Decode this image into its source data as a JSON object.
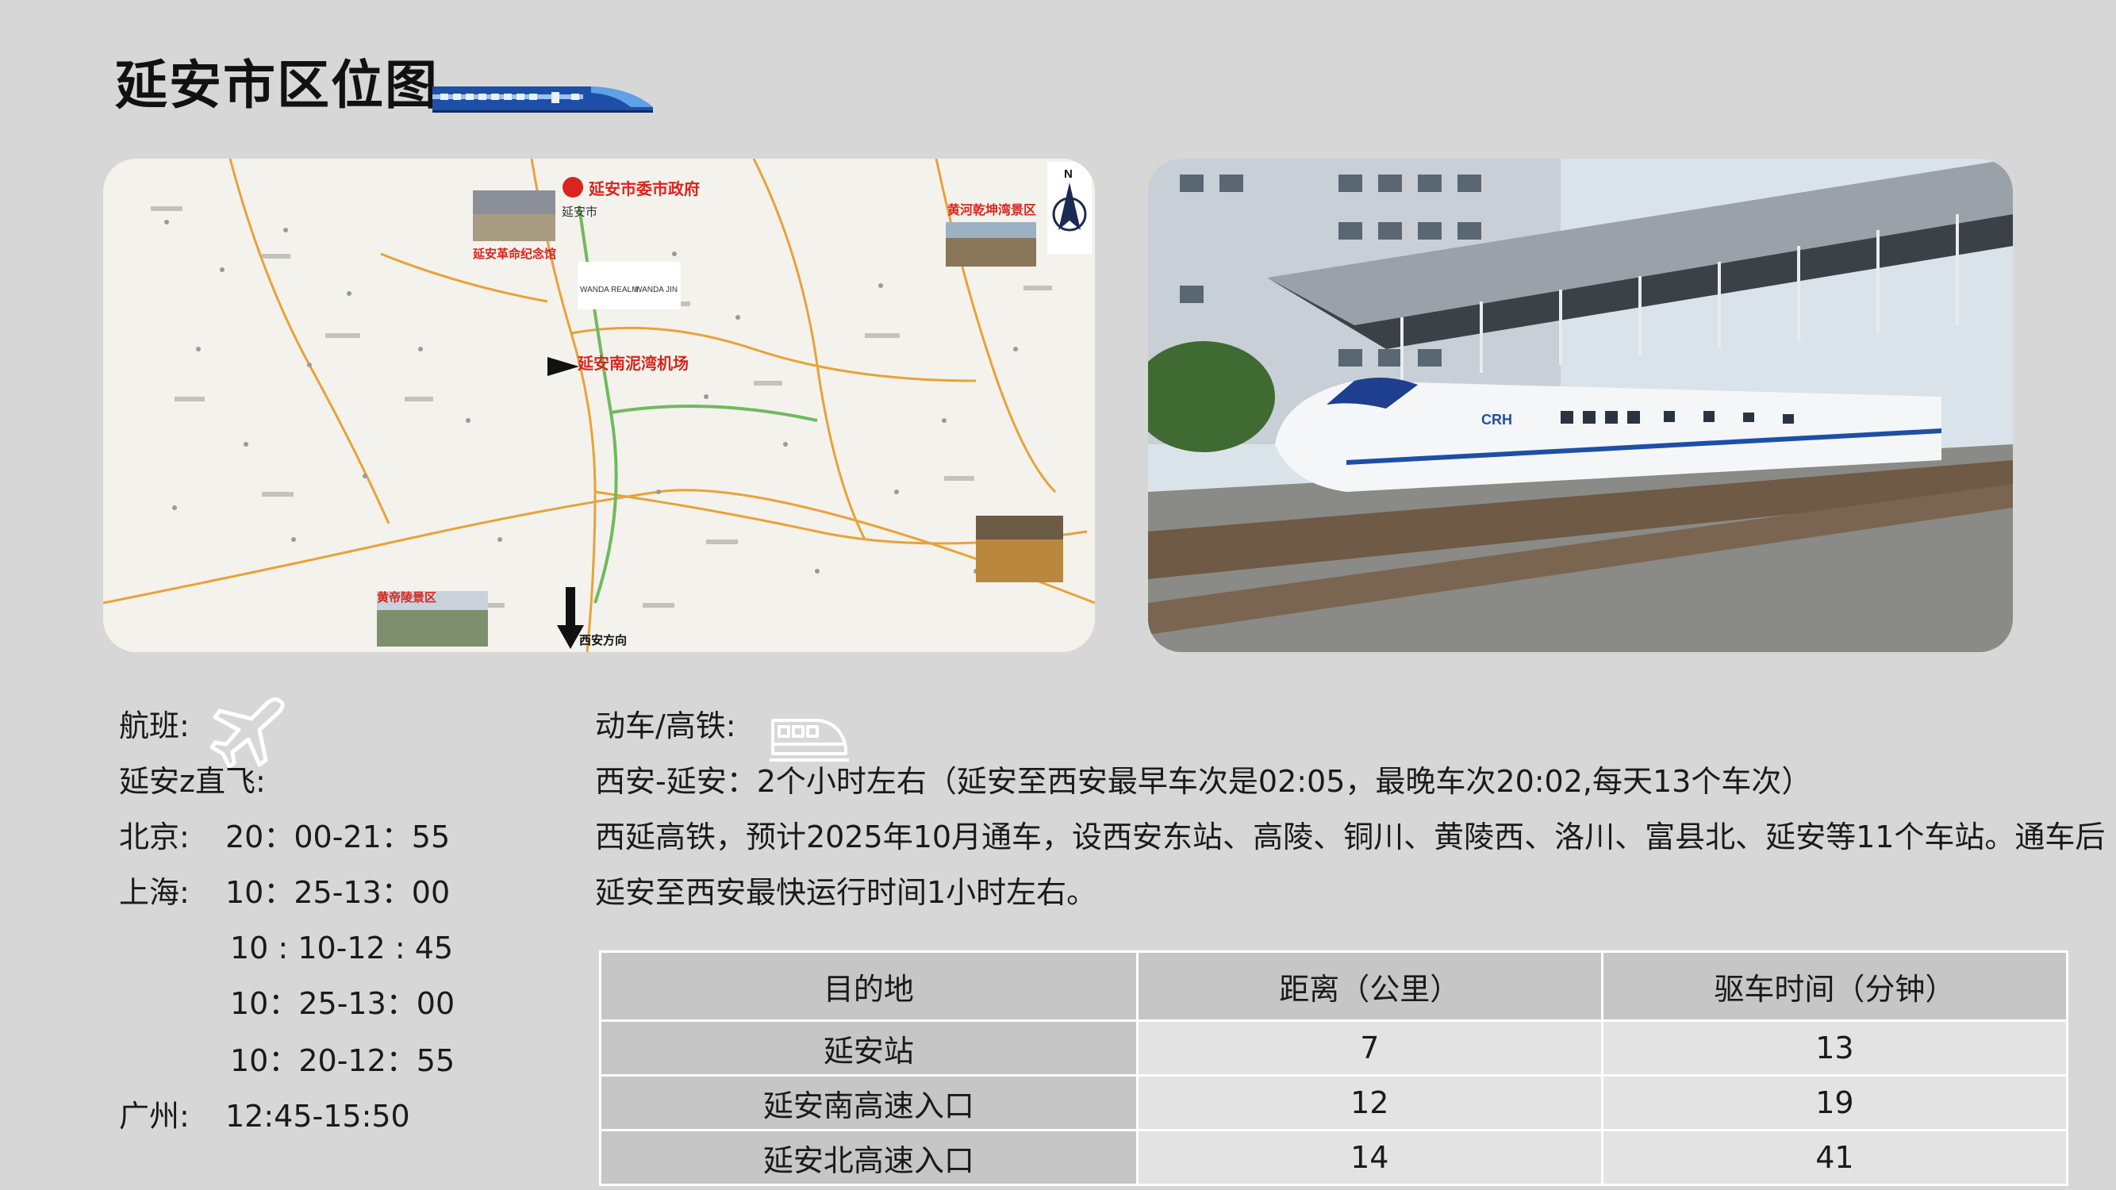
{
  "header": {
    "title": "延安市区位图"
  },
  "map": {
    "labels": {
      "gov": "延安市委市政府",
      "city": "延安市",
      "memorial": "延安革命纪念馆",
      "wanda1": "WANDA REALM",
      "wanda2": "WANDA JIN",
      "airport": "延安南泥湾机场",
      "hukou": "黄河乾坤湾景区",
      "huangdi": "黄帝陵景区",
      "xian": "西安方向",
      "north": "N"
    }
  },
  "flight": {
    "heading": "航班:",
    "direct": "延安z直飞:",
    "rows": [
      {
        "city": "北京:",
        "time": "20：00-21：55"
      },
      {
        "city": "上海:",
        "time": "10：25-13：00"
      },
      {
        "city": "",
        "time": "10 : 10-12 : 45"
      },
      {
        "city": "",
        "time": "10：25-13：00"
      },
      {
        "city": "",
        "time": "10：20-12：55"
      },
      {
        "city": "广州:",
        "time": "12:45-15:50"
      }
    ]
  },
  "rail": {
    "heading": "动车/高铁:",
    "line1": "西安-延安：2个小时左右（延安至西安最早车次是02:05，最晚车次20:02,每天13个车次）",
    "line2": "西延高铁，预计2025年10月通车，设西安东站、高陵、铜川、黄陵西、洛川、富县北、延安等11个车站。通车后",
    "line3": "延安至西安最快运行时间1小时左右。"
  },
  "table": {
    "headers": [
      "目的地",
      "距离（公里）",
      "驱车时间（分钟）"
    ],
    "rows": [
      [
        "延安站",
        "7",
        "13"
      ],
      [
        "延安南高速入口",
        "12",
        "19"
      ],
      [
        "延安北高速入口",
        "14",
        "41"
      ]
    ]
  },
  "colors": {
    "background": "#d7d7d7",
    "train_blue": "#1d4fa8",
    "map_route": "#e8a23a",
    "map_label": "#d9251d"
  }
}
